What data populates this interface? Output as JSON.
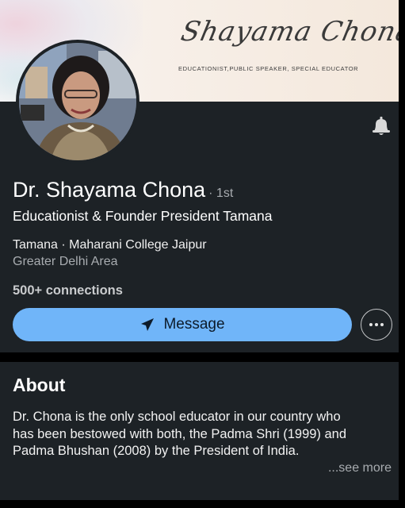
{
  "banner": {
    "signature": "Shayama Chona",
    "subtitle": "EDUCATIONIST,PUBLIC SPEAKER, SPECIAL EDUCATOR"
  },
  "profile": {
    "name": "Dr. Shayama Chona",
    "degree": "· 1st",
    "headline": "Educationist &  Founder President Tamana",
    "company": "Tamana · Maharani College Jaipur",
    "location": "Greater Delhi Area",
    "connections": "500+ connections"
  },
  "actions": {
    "message_label": "Message",
    "message_icon": "send-icon",
    "more_icon": "more-horizontal-icon",
    "bell_icon": "bell-icon"
  },
  "about": {
    "title": "About",
    "lines": [
      "Dr. Chona is the  only school educator in our country who",
      "has been bestowed with both, the Padma Shri (1999) and",
      "Padma Bhushan (2008) by the President of India."
    ],
    "see_more": "...see more"
  },
  "colors": {
    "card_bg": "#1d2226",
    "page_bg": "#000000",
    "accent": "#70b5f9",
    "muted_text": "#a8acb0"
  }
}
